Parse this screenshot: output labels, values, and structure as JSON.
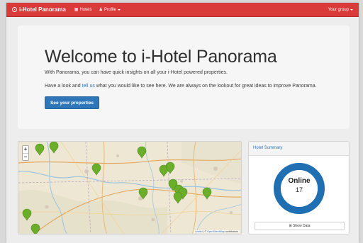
{
  "navbar": {
    "brand": "i-Hotel Panorama",
    "hotels_label": "Hotels",
    "profile_label": "Profile",
    "group_label": "Your group"
  },
  "jumbotron": {
    "title": "Welcome to i-Hotel Panorama",
    "intro": "With Panorama, you can have quick insights on all your i-Hotel powered properties.",
    "feedback_before": "Have a look and ",
    "feedback_link": "tell us",
    "feedback_after": " what you would like to see here. We are always on the lookout for great ideas to improve Panorama.",
    "button_label": "See your properties"
  },
  "map": {
    "zoom_in": "+",
    "zoom_out": "−",
    "attribution_leaflet": "Leaflet",
    "attribution_separator": " | © ",
    "attribution_osm": "OpenStreetMap",
    "attribution_suffix": " contributors",
    "marker_color": "#6aae2a"
  },
  "hotel_summary": {
    "title": "Hotel Summary",
    "status_label": "Online",
    "status_count": "17",
    "online_fraction": 1.0,
    "ring_color": "#1f6fb2",
    "show_data_label": "Show Data"
  },
  "colors": {
    "navbar": "#d93a3a",
    "primary": "#2f76b9",
    "link": "#2d77c2"
  }
}
